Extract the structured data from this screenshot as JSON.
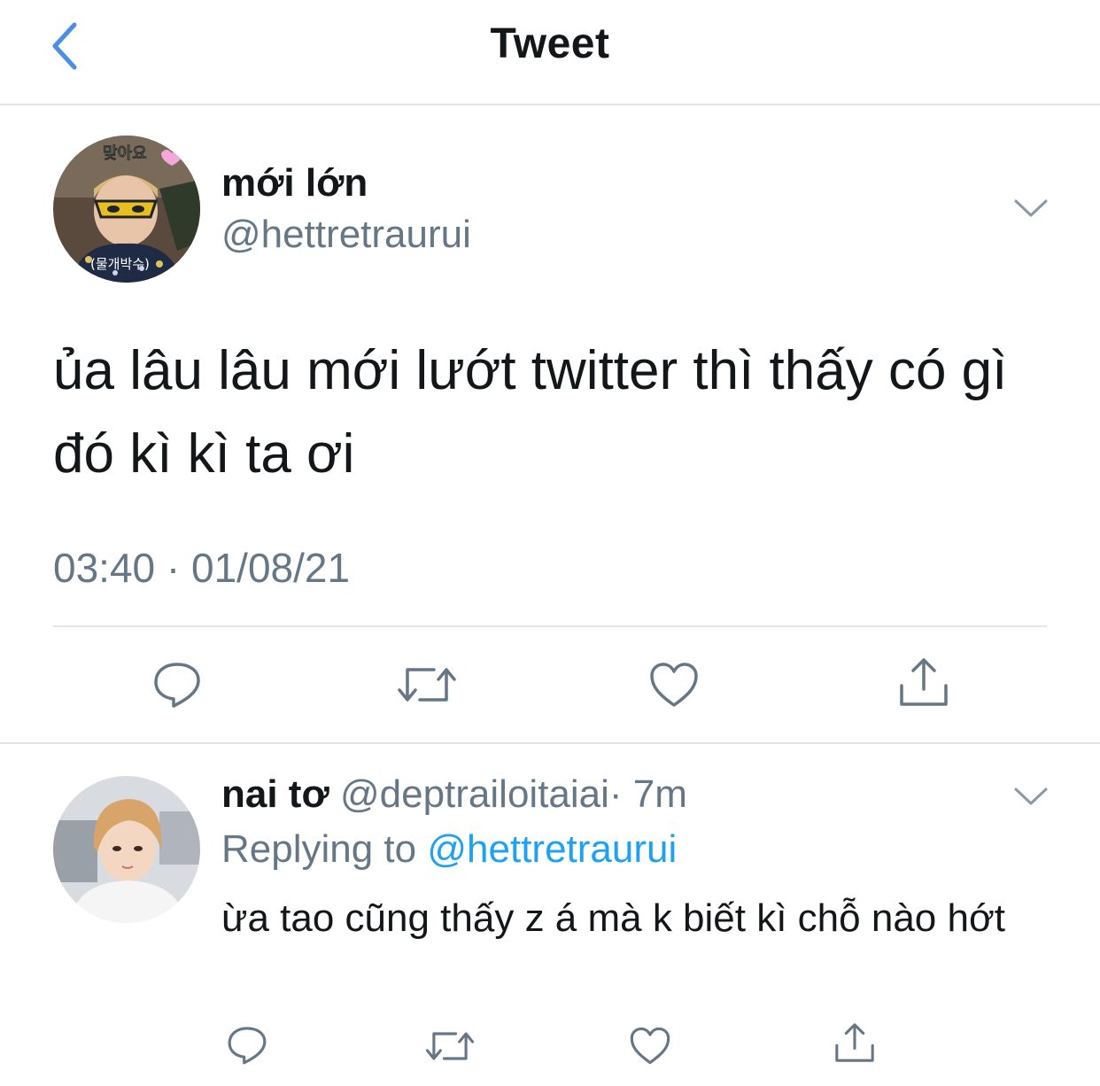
{
  "header": {
    "title": "Tweet",
    "back_icon": "chevron-left-icon"
  },
  "tweet": {
    "display_name": "mới lớn",
    "handle": "@hettretraurui",
    "avatar_caption_top": "맞아요",
    "avatar_caption_bottom": "(물개박수)",
    "text": "ủa lâu lâu mới lướt twitter thì thấy có gì đó kì kì ta ơi",
    "timestamp": "03:40 · 01/08/21",
    "actions": [
      "reply-icon",
      "retweet-icon",
      "like-icon",
      "share-icon"
    ]
  },
  "reply": {
    "display_name": "nai tơ",
    "handle": "@deptrailoitaiai",
    "time": "· 7m",
    "replying_label": "Replying to",
    "replying_to": "@hettretraurui",
    "text": "ừa tao cũng thấy z á mà k biết kì chỗ nào hớt"
  },
  "colors": {
    "accent": "#1da1f2",
    "back": "#4a90e2",
    "secondary_text": "#657786",
    "icon": "#657786",
    "divider": "#e1e4e8"
  }
}
